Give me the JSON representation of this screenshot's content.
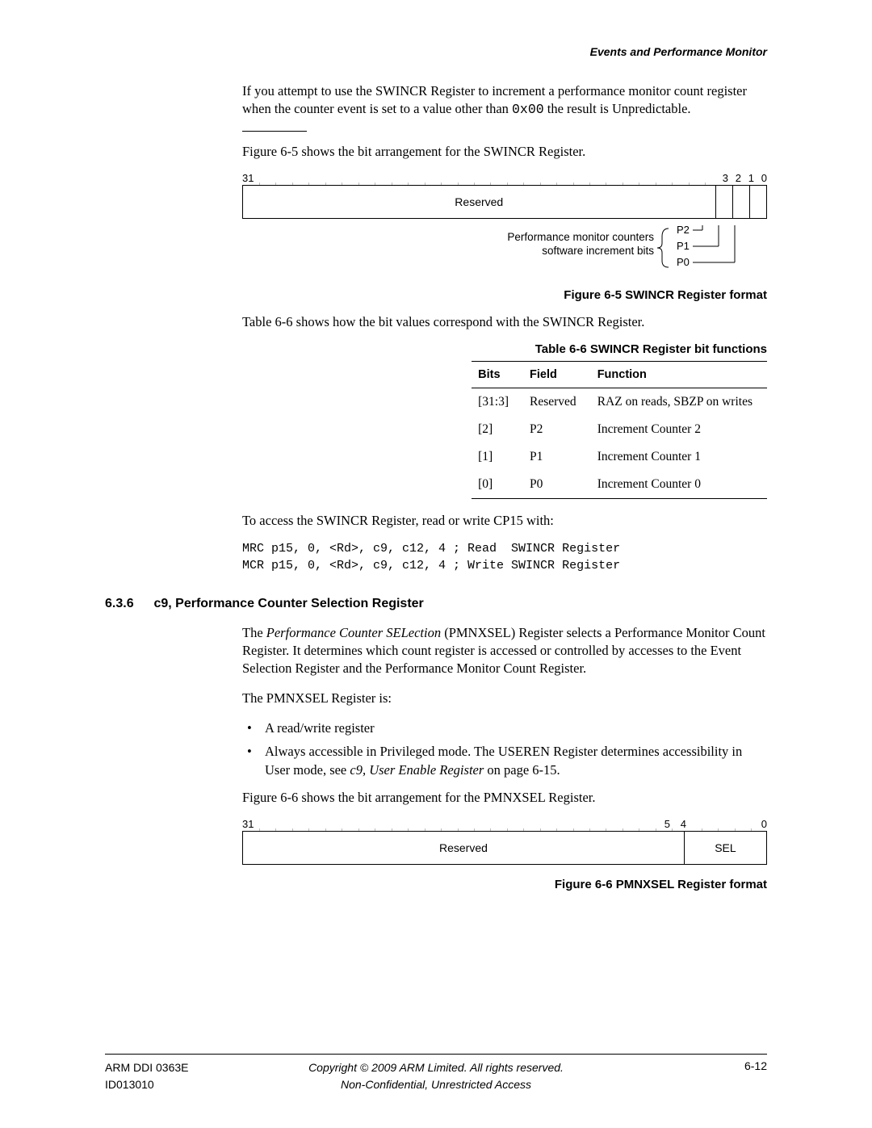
{
  "header": {
    "section_title": "Events and Performance Monitor"
  },
  "intro": {
    "p1_a": "If you attempt to use the SWINCR Register to increment a performance monitor count register when the counter event is set to a value other than ",
    "p1_code": "0x00",
    "p1_b": " the result is Unpredictable.",
    "p2": "Figure 6-5 shows the bit arrangement for the SWINCR Register."
  },
  "fig65": {
    "bit31": "31",
    "bit3": "3",
    "bit2": "2",
    "bit1": "1",
    "bit0": "0",
    "reserved": "Reserved",
    "annot_line1": "Performance monitor counters",
    "annot_line2": "software increment bits",
    "p2": "P2",
    "p1": "P1",
    "p0": "P0",
    "caption": "Figure 6-5 SWINCR Register format"
  },
  "tbl66_intro": "Table 6-6 shows how the bit values correspond with the SWINCR Register.",
  "tbl66": {
    "caption": "Table 6-6 SWINCR Register bit functions",
    "head": {
      "bits": "Bits",
      "field": "Field",
      "func": "Function"
    },
    "rows": [
      {
        "bits": "[31:3]",
        "field": "Reserved",
        "func": "RAZ on reads, SBZP on writes"
      },
      {
        "bits": "[2]",
        "field": "P2",
        "func": "Increment Counter 2"
      },
      {
        "bits": "[1]",
        "field": "P1",
        "func": "Increment Counter 1"
      },
      {
        "bits": "[0]",
        "field": "P0",
        "func": "Increment Counter 0"
      }
    ]
  },
  "access": {
    "lead": "To access the SWINCR Register, read or write CP15 with:",
    "code": "MRC p15, 0, <Rd>, c9, c12, 4 ; Read  SWINCR Register\nMCR p15, 0, <Rd>, c9, c12, 4 ; Write SWINCR Register"
  },
  "section636": {
    "num": "6.3.6",
    "title": "c9, Performance Counter Selection Register",
    "p1_a": "The ",
    "p1_i": "Performance Counter SELection",
    "p1_b": " (PMNXSEL) Register selects a Performance Monitor Count Register. It determines which count register is accessed or controlled by accesses to the Event Selection Register and the Performance Monitor Count Register.",
    "p2": "The PMNXSEL Register is:",
    "b1": "A read/write register",
    "b2_a": "Always accessible in Privileged mode. The USEREN Register determines accessibility in User mode, see ",
    "b2_i": "c9, User Enable Register",
    "b2_b": " on page 6-15.",
    "p3": "Figure 6-6 shows the bit arrangement for the PMNXSEL Register."
  },
  "fig66": {
    "bit31": "31",
    "bit5": "5",
    "bit4": "4",
    "bit0": "0",
    "reserved": "Reserved",
    "sel": "SEL",
    "caption": "Figure 6-6 PMNXSEL Register format"
  },
  "footer": {
    "doc": "ARM DDI 0363E",
    "id": "ID013010",
    "copy": "Copyright © 2009 ARM Limited. All rights reserved.",
    "conf": "Non-Confidential, Unrestricted Access",
    "page": "6-12"
  }
}
